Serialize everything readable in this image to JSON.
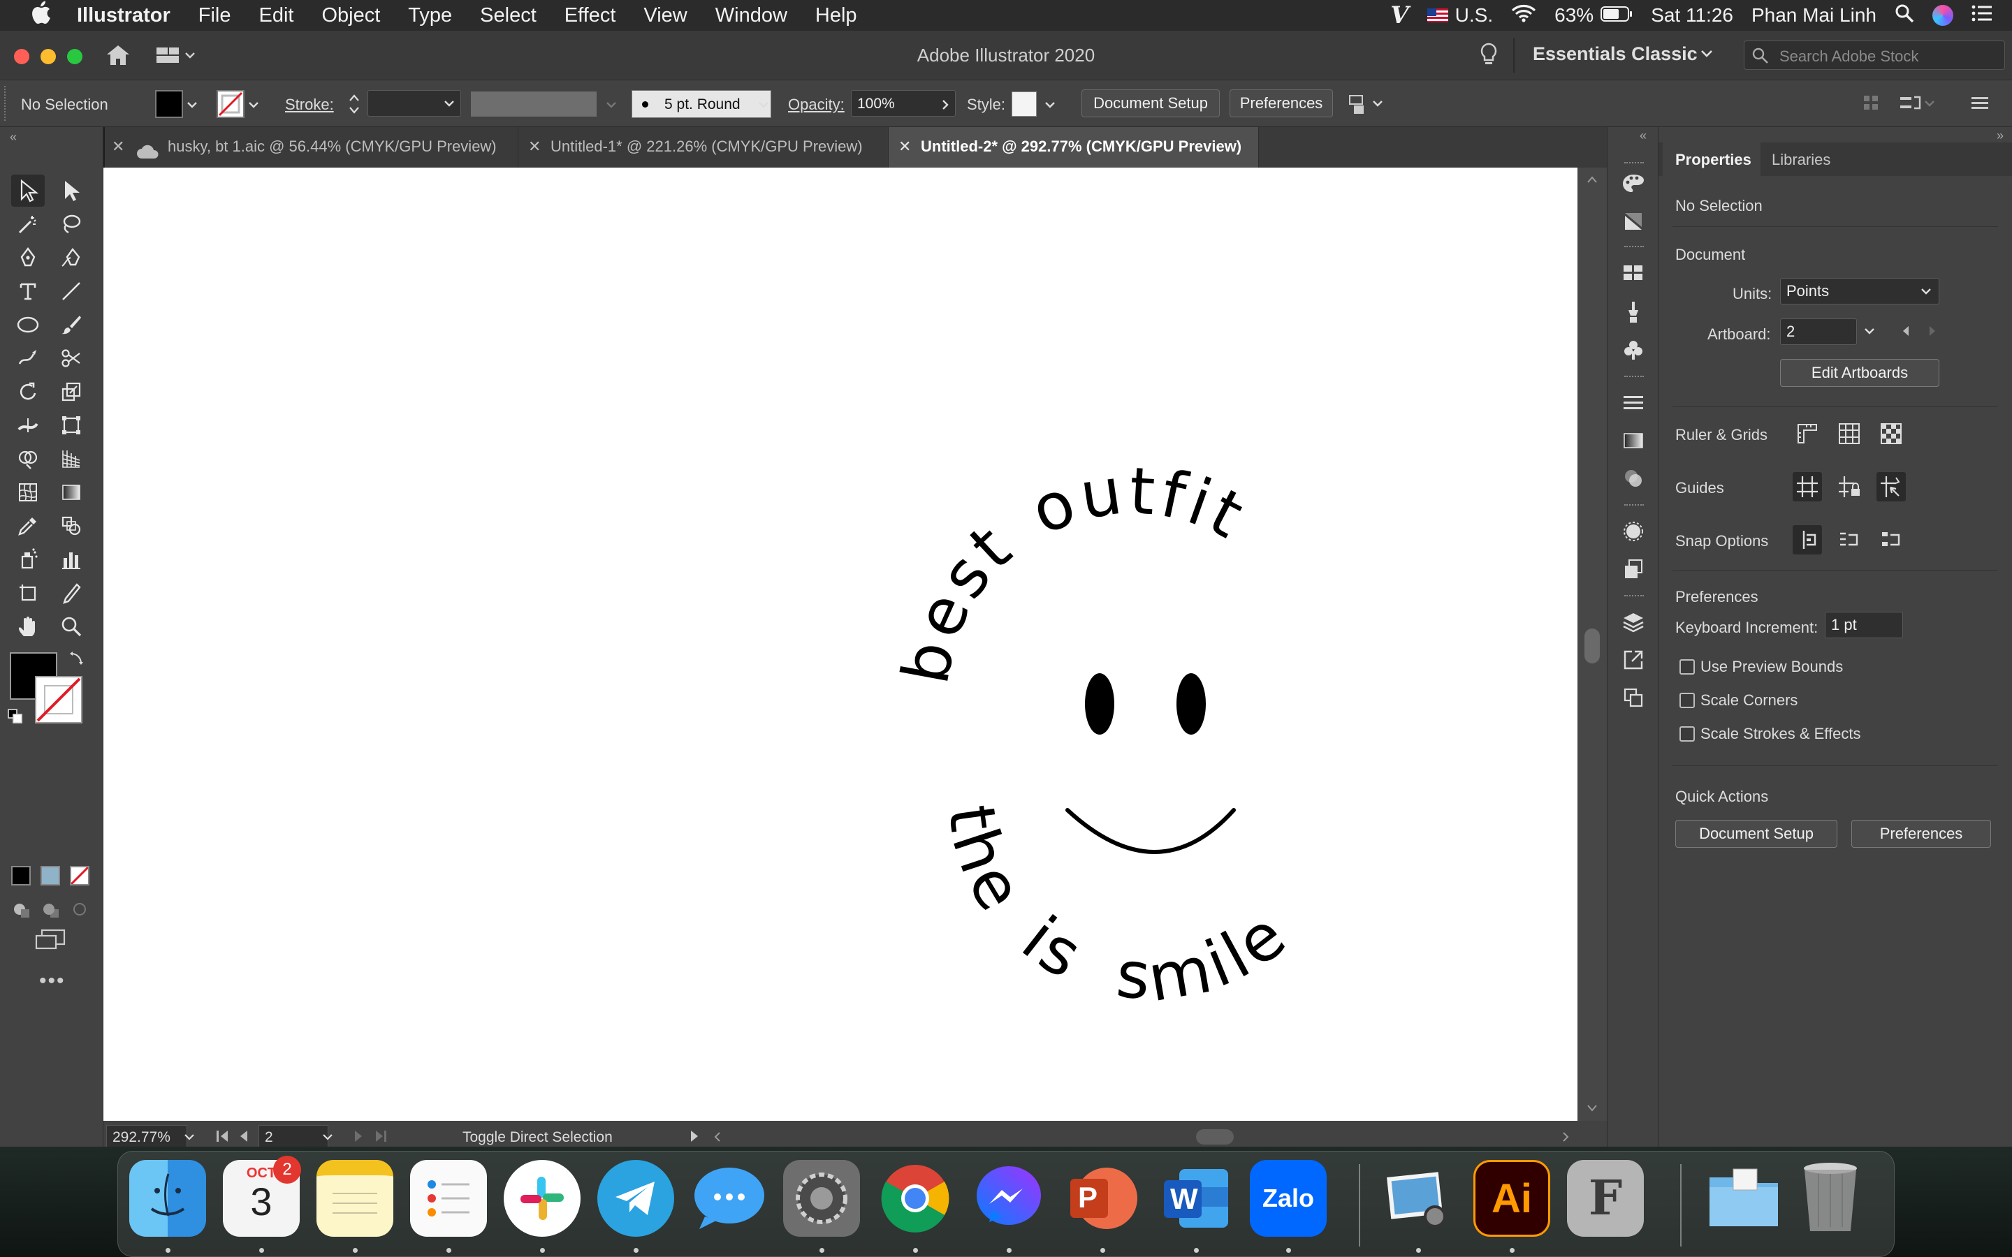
{
  "menubar": {
    "app_name": "Illustrator",
    "items": [
      "File",
      "Edit",
      "Object",
      "Type",
      "Select",
      "Effect",
      "View",
      "Window",
      "Help"
    ],
    "input_source": "U.S.",
    "battery": "63%",
    "datetime": "Sat 11:26",
    "user": "Phan Mai Linh"
  },
  "titlebar": {
    "title": "Adobe Illustrator 2020",
    "workspace": "Essentials Classic",
    "search_placeholder": "Search Adobe Stock"
  },
  "control_bar": {
    "selection": "No Selection",
    "stroke_label": "Stroke:",
    "brush": "5 pt. Round",
    "opacity_label": "Opacity:",
    "opacity_value": "100%",
    "style_label": "Style:",
    "document_setup": "Document Setup",
    "preferences": "Preferences"
  },
  "tabs": [
    {
      "label": "husky, bt 1.aic @ 56.44% (CMYK/GPU Preview)",
      "active": false
    },
    {
      "label": "Untitled-1* @ 221.26% (CMYK/GPU Preview)",
      "active": false
    },
    {
      "label": "Untitled-2* @ 292.77% (CMYK/GPU Preview)",
      "active": true
    }
  ],
  "artwork": {
    "words": [
      "best",
      "outfit",
      "smile",
      "is",
      "the"
    ]
  },
  "status_bar": {
    "zoom": "292.77%",
    "artboard": "2",
    "tool_hint": "Toggle Direct Selection"
  },
  "properties": {
    "tab_properties": "Properties",
    "tab_libraries": "Libraries",
    "selection": "No Selection",
    "document_heading": "Document",
    "units_label": "Units:",
    "units_value": "Points",
    "artboard_label": "Artboard:",
    "artboard_value": "2",
    "edit_artboards": "Edit Artboards",
    "ruler_grids": "Ruler & Grids",
    "guides": "Guides",
    "snap_options": "Snap Options",
    "preferences_heading": "Preferences",
    "keyboard_increment_label": "Keyboard Increment:",
    "keyboard_increment_value": "1 pt",
    "use_preview_bounds": "Use Preview Bounds",
    "scale_corners": "Scale Corners",
    "scale_strokes_effects": "Scale Strokes & Effects",
    "quick_actions": "Quick Actions",
    "qa_document_setup": "Document Setup",
    "qa_preferences": "Preferences"
  },
  "dock": {
    "calendar_month": "OCT",
    "calendar_day": "3",
    "calendar_badge": "2",
    "powerpoint_letter": "P",
    "word_letter": "W",
    "zalo_label": "Zalo",
    "illustrator_label": "Ai",
    "fontbook_letter": "F"
  },
  "colors": {
    "accent": "#1473e6",
    "panel": "#424242",
    "artboard": "#ffffff"
  }
}
